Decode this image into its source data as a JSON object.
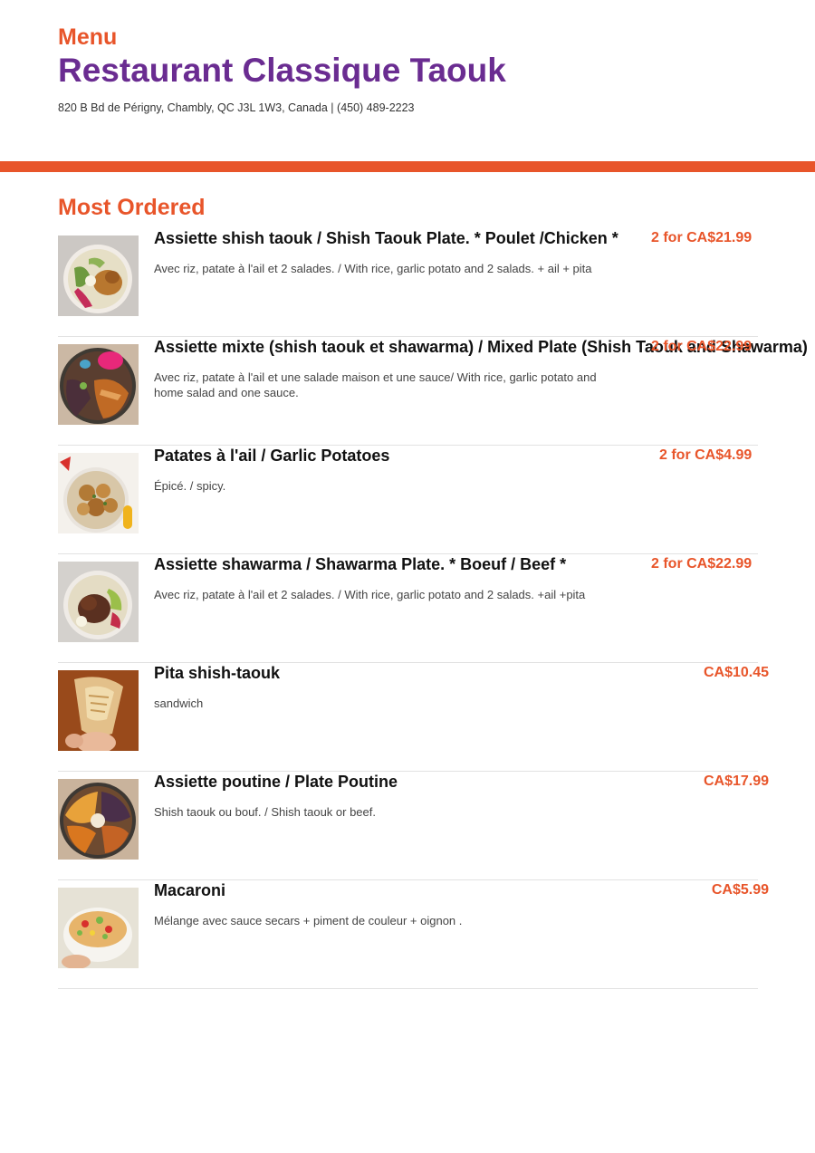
{
  "header": {
    "menu_label": "Menu",
    "restaurant_name": "Restaurant Classique Taouk",
    "address": "820 B Bd de Périgny, Chambly, QC J3L 1W3, Canada | (450) 489-2223"
  },
  "section": {
    "title": "Most Ordered"
  },
  "colors": {
    "accent": "#e8552a",
    "brand": "#6a2c91"
  },
  "items": [
    {
      "title": "Assiette shish taouk /  Shish Taouk Plate. * Poulet /Chicken *",
      "description": "Avec riz, patate à l'ail et 2 salades. / With rice, garlic potato and 2 salads. + ail + pita",
      "price": "2 for CA$21.99",
      "image": "chicken-plate-image"
    },
    {
      "title": "Assiette mixte (shish taouk et shawarma) /  Mixed Plate (Shish Taouk and Shawarma)",
      "description": "Avec riz, patate à l'ail et une salade maison et une sauce/ With rice, garlic potato and home salad and one sauce.",
      "price": "2 for CA$22.99",
      "image": "mixed-plate-image"
    },
    {
      "title": "Patates à l'ail / Garlic Potatoes",
      "description": "Épicé. / spicy.",
      "price": "2 for CA$4.99",
      "image": "garlic-potatoes-image"
    },
    {
      "title": "Assiette shawarma / Shawarma Plate. * Boeuf / Beef *",
      "description": "Avec riz, patate à l'ail et 2 salades. / With rice, garlic potato and 2 salads. +ail +pita",
      "price": "2 for CA$22.99",
      "image": "shawarma-plate-image"
    },
    {
      "title": "Pita shish-taouk",
      "description": "sandwich",
      "price": "CA$10.45",
      "image": "pita-wrap-image"
    },
    {
      "title": "Assiette poutine  / Plate Poutine",
      "description": "Shish taouk ou bouf. / Shish taouk or beef.",
      "price": "CA$17.99",
      "image": "poutine-plate-image"
    },
    {
      "title": "Macaroni",
      "description": "Mélange avec sauce secars + piment de couleur + oignon .",
      "price": "CA$5.99",
      "image": "macaroni-salad-image"
    }
  ]
}
